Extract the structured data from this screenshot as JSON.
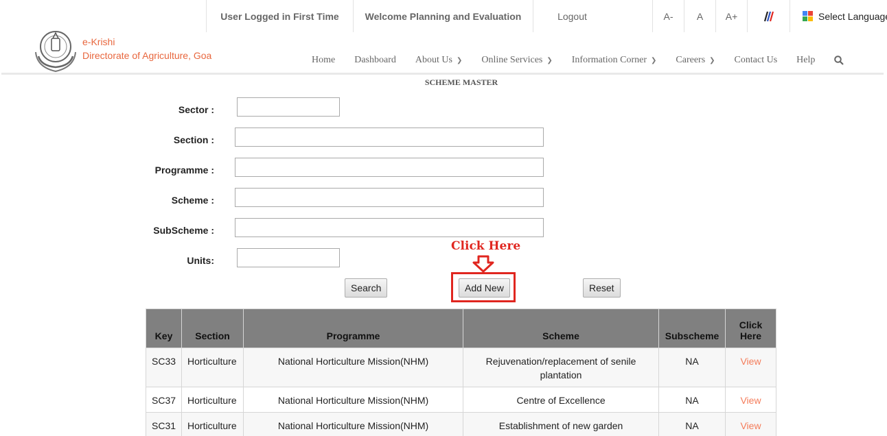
{
  "topbar": {
    "user_status": "User Logged in First Time",
    "welcome": "Welcome Planning and Evaluation",
    "logout": "Logout",
    "font_decrease": "A-",
    "font_normal": "A",
    "font_increase": "A+",
    "language_label": "Select Language"
  },
  "brand": {
    "line1": "e-Krishi",
    "line2": "Directorate of Agriculture, Goa"
  },
  "nav": {
    "home": "Home",
    "dashboard": "Dashboard",
    "about": "About Us",
    "services": "Online Services",
    "info": "Information Corner",
    "careers": "Careers",
    "contact": "Contact Us",
    "help": "Help"
  },
  "page": {
    "title": "SCHEME MASTER"
  },
  "form": {
    "sector_label": "Sector :",
    "section_label": "Section :",
    "programme_label": "Programme :",
    "scheme_label": "Scheme :",
    "subscheme_label": "SubScheme :",
    "units_label": "Units:",
    "sector_value": "",
    "section_value": "",
    "programme_value": "",
    "scheme_value": "",
    "subscheme_value": "",
    "units_value": ""
  },
  "buttons": {
    "search": "Search",
    "add_new": "Add New",
    "reset": "Reset"
  },
  "annotation": {
    "text": "Click Here",
    "color": "#e0261f"
  },
  "table": {
    "headers": [
      "Key",
      "Section",
      "Programme",
      "Scheme",
      "Subscheme",
      "Click Here"
    ],
    "rows": [
      {
        "key": "SC33",
        "section": "Horticulture",
        "programme": "National Horticulture Mission(NHM)",
        "scheme": "Rejuvenation/replacement of senile plantation",
        "subscheme": "NA",
        "action": "View"
      },
      {
        "key": "SC37",
        "section": "Horticulture",
        "programme": "National Horticulture Mission(NHM)",
        "scheme": "Centre of Excellence",
        "subscheme": "NA",
        "action": "View"
      },
      {
        "key": "SC31",
        "section": "Horticulture",
        "programme": "National Horticulture Mission(NHM)",
        "scheme": "Establishment of new garden",
        "subscheme": "NA",
        "action": "View"
      }
    ]
  },
  "colors": {
    "brand": "#e8663d",
    "link": "#f47c5a",
    "table_header": "#808080",
    "highlight": "#e0261f"
  }
}
